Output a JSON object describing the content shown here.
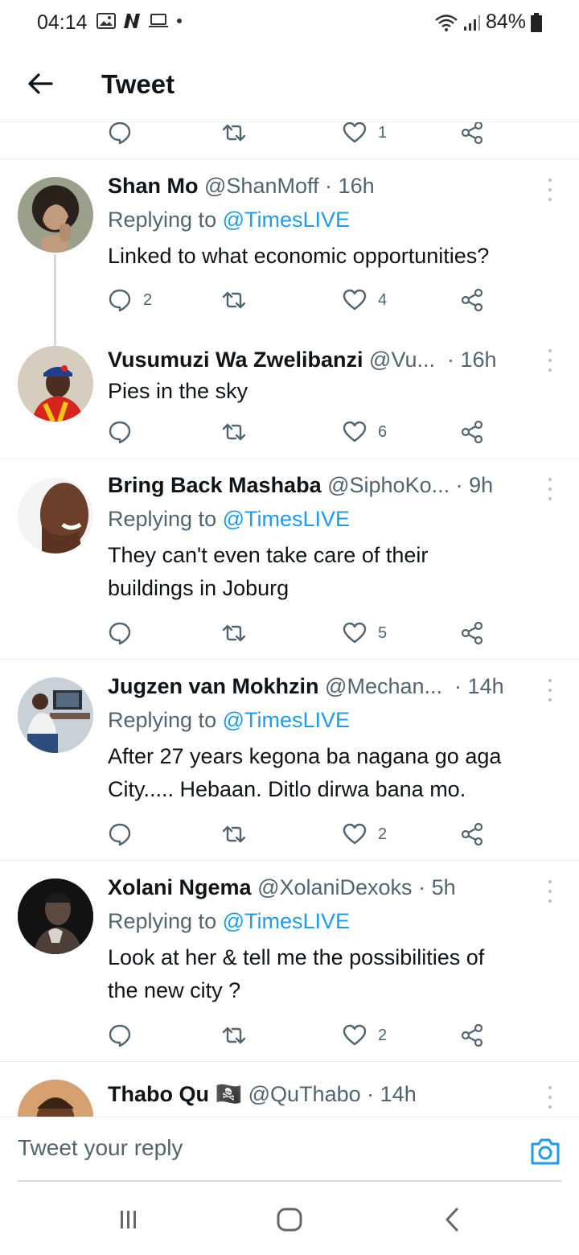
{
  "status_bar": {
    "time": "04:14",
    "battery": "84%"
  },
  "header": {
    "title": "Tweet"
  },
  "top_actions": {
    "reply_count": "",
    "retweet_count": "",
    "like_count": "1"
  },
  "tweets": [
    {
      "name": "Shan Mo",
      "handle": "@ShanMoff",
      "time": "16h",
      "replying_label": "Replying to",
      "replying_to": "@TimesLIVE",
      "text": "Linked to what economic opportunities?",
      "reply_count": "2",
      "retweet_count": "",
      "like_count": "4"
    },
    {
      "name": "Vusumuzi Wa Zwelibanzi",
      "handle": "@Vu...",
      "time": "16h",
      "text": "Pies in the sky",
      "reply_count": "",
      "retweet_count": "",
      "like_count": "6"
    },
    {
      "name": "Bring Back Mashaba",
      "handle": "@SiphoKo...",
      "time": "9h",
      "replying_label": "Replying to",
      "replying_to": "@TimesLIVE",
      "text_line1": "They can't even take care of their",
      "text_line2": "buildings in Joburg",
      "reply_count": "",
      "retweet_count": "",
      "like_count": "5"
    },
    {
      "name": "Jugzen van Mokhzin",
      "handle": "@Mechan...",
      "time": "14h",
      "replying_label": "Replying to",
      "replying_to": "@TimesLIVE",
      "text_line1": "After 27 years kegona ba nagana go aga",
      "text_line2": "City..... Hebaan. Ditlo dirwa bana mo.",
      "reply_count": "",
      "retweet_count": "",
      "like_count": "2"
    },
    {
      "name": "Xolani Ngema",
      "handle": "@XolaniDexoks",
      "time": "5h",
      "replying_label": "Replying to",
      "replying_to": "@TimesLIVE",
      "text_line1": "Look at her & tell me the possibilities of",
      "text_line2": "the new city ?",
      "reply_count": "",
      "retweet_count": "",
      "like_count": "2"
    },
    {
      "name": "Thabo Qu",
      "emoji": "🏴‍☠️",
      "handle": "@QuThabo",
      "time": "14h"
    }
  ],
  "reply_bar": {
    "placeholder": "Tweet your reply"
  },
  "icons": {
    "back": "arrow-left-icon",
    "reply": "comment-icon",
    "retweet": "retweet-icon",
    "like": "heart-icon",
    "share": "share-icon",
    "more": "more-vertical-icon",
    "camera": "camera-icon"
  },
  "colors": {
    "link": "#1d9bf0",
    "secondary_text": "#536471",
    "divider": "#eff3f4"
  }
}
